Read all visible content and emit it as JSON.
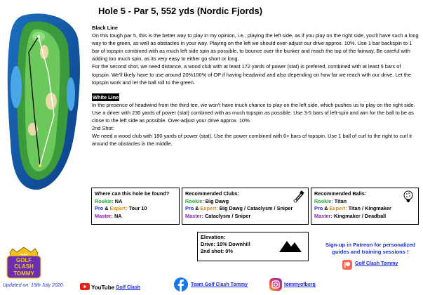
{
  "page": {
    "title": "Hole 5 - Par 5, 552 yds (Nordic Fjords)",
    "updated": "Updated on: 15th July 2020"
  },
  "black_line": {
    "heading": "Black Line",
    "p1": "On this tough par 5, this is the better way to play in my opinion, i.e., playing the left side, as if you play on the right side, you'll have such a long way to the green, as well as obstacles in your way. Playing on the left we should over-adjust our drive approx. 10%. Use 1 bar backspin to 1 bar of topspin combined with as much left side spin as possible, to bounce over the bunker and reach the top of the fairway. Be careful with adding too much spin, as its very easy to either go short or long.",
    "p2": "For the second shot, we need distance, a wood club with at least 172 yards of power (stat) is prefered, combined with at least 5 bars of topspin. We'll likely have to use around 20%100% of OP if having headwind and also depending on how far we reach with our drive. Let the topspin work and let the ball roll to the green."
  },
  "white_line": {
    "heading": "White Line",
    "p1": "In the presence of headwind from the third tee, we won't have much chance to play on the left side, which pushes us to play on the right side. Use a driver with 230 yards of power (stat) combined with as much topspin as possible. Use 3-5 bars of left-spin and aim for the ball to be as close to the left side as possible. Over-adjust your drive approx. 10%.",
    "p2_label": "2nd Shot:",
    "p3": "We need a wood club with 180 yards of power (stat). Use the power combined with 6+ bars of topspin. Use 1 ball of curl to the right to curl it around the obstacles in the middle."
  },
  "found_box": {
    "heading": "Where can this hole be found?",
    "rookie_label": "Rookie:",
    "rookie_value": "NA",
    "pro_label": "Pro",
    "amp": "&",
    "expert_label": "Expert:",
    "pro_value": "Tour 10",
    "master_label": "Master:",
    "master_value": "NA"
  },
  "clubs_box": {
    "heading": "Recommended Clubs:",
    "rookie_label": "Rookie:",
    "rookie_value": "Big Dawg",
    "pro_label": "Pro",
    "amp": "&",
    "expert_label": "Expert:",
    "pro_value": "Big Dawg / Cataclysm / Sniper",
    "master_label": "Master:",
    "master_value": "Cataclysm / Sniper"
  },
  "balls_box": {
    "heading": "Recommended Balls:",
    "rookie_label": "Rookie:",
    "rookie_value": "Titan",
    "pro_label": "Pro",
    "amp": "&",
    "expert_label": "Expert:",
    "pro_value": "Titan / Kingmaker",
    "master_label": "Master:",
    "master_value": "Kingmaker / Deadball"
  },
  "elevation": {
    "heading": "Elevation:",
    "drive": "Drive: 10% Downhill",
    "second": "2nd shot: 0%"
  },
  "patreon": {
    "text": "Sign-up in Patreon for personalized guides and training sessions !",
    "link": "Golf Clash Tommy"
  },
  "logo": {
    "line1": "TEAM",
    "line2": "GOLF",
    "line3": "CLASH",
    "line4": "TOMMY"
  },
  "footer": {
    "youtube_word": "YouTube",
    "youtube_link": "Golf Clash",
    "facebook_link": "Team Golf Clash Tommy",
    "instagram_link": "tommyofberg"
  },
  "colors": {
    "rookie": "#21a33a",
    "pro": "#1b2bd6",
    "expert": "#e08a10",
    "master": "#8b1fb0",
    "link": "#1b2bd6",
    "youtube": "#e62117",
    "facebook": "#1877f2",
    "patreon": "#f96854"
  },
  "icons": [
    "hole-map-image",
    "golf-club-icon",
    "golf-ball-icon",
    "mountain-icon",
    "youtube-icon",
    "facebook-icon",
    "instagram-icon",
    "patreon-icon",
    "team-logo"
  ]
}
